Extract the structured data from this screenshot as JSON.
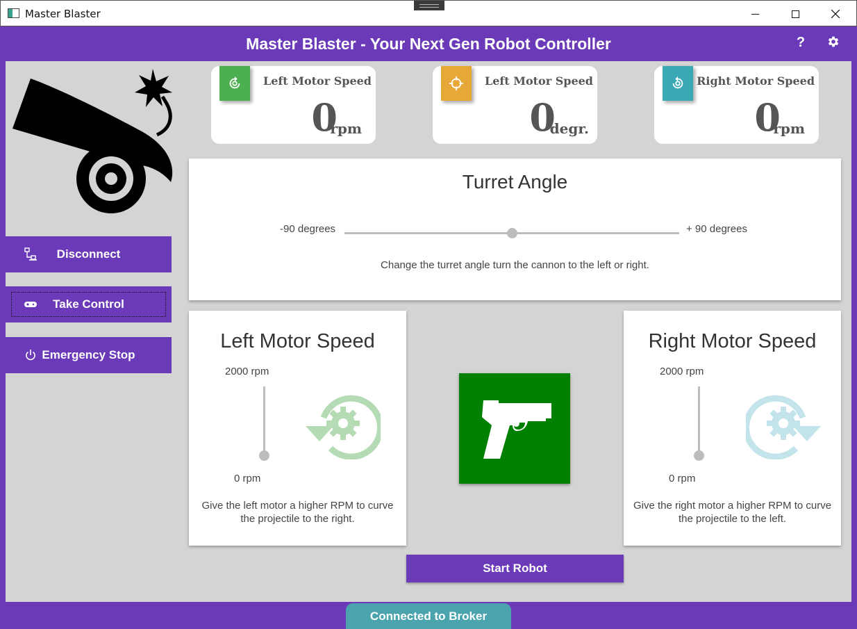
{
  "window": {
    "title": "Master Blaster"
  },
  "header": {
    "title": "Master Blaster - Your Next Gen Robot Controller",
    "help_label": "?"
  },
  "sidebar": {
    "disconnect_label": "Disconnect",
    "take_control_label": "Take Control",
    "emergency_stop_label": "Emergency Stop"
  },
  "stats": [
    {
      "label": "Left Motor Speed",
      "value": "0",
      "unit": "rpm",
      "color": "#4caf50",
      "icon": "rotate-gear-icon"
    },
    {
      "label": "Left Motor Speed",
      "value": "0",
      "unit": "degr.",
      "color": "#e8a838",
      "icon": "crosshair-icon"
    },
    {
      "label": "Right Motor Speed",
      "value": "0",
      "unit": "rpm",
      "color": "#3ba8b5",
      "icon": "rotate-gear-icon"
    }
  ],
  "turret": {
    "title": "Turret Angle",
    "min_label": "-90 degrees",
    "max_label": "+ 90 degrees",
    "value_degrees": 0,
    "description": "Change the turret angle turn the cannon to the left or right."
  },
  "left_motor": {
    "title": "Left Motor Speed",
    "max_label": "2000 rpm",
    "min_label": "0 rpm",
    "value_rpm": 0,
    "description": "Give the left motor a higher RPM to curve the projectile to the right."
  },
  "right_motor": {
    "title": "Right Motor Speed",
    "max_label": "2000 rpm",
    "min_label": "0 rpm",
    "value_rpm": 0,
    "description": "Give the right motor a higher RPM to curve the projectile to the left."
  },
  "start_label": "Start Robot",
  "status": {
    "label": "Connected to Broker"
  },
  "colors": {
    "accent": "#6a3ab8",
    "fire": "#008000",
    "status": "#4aa3ad"
  }
}
